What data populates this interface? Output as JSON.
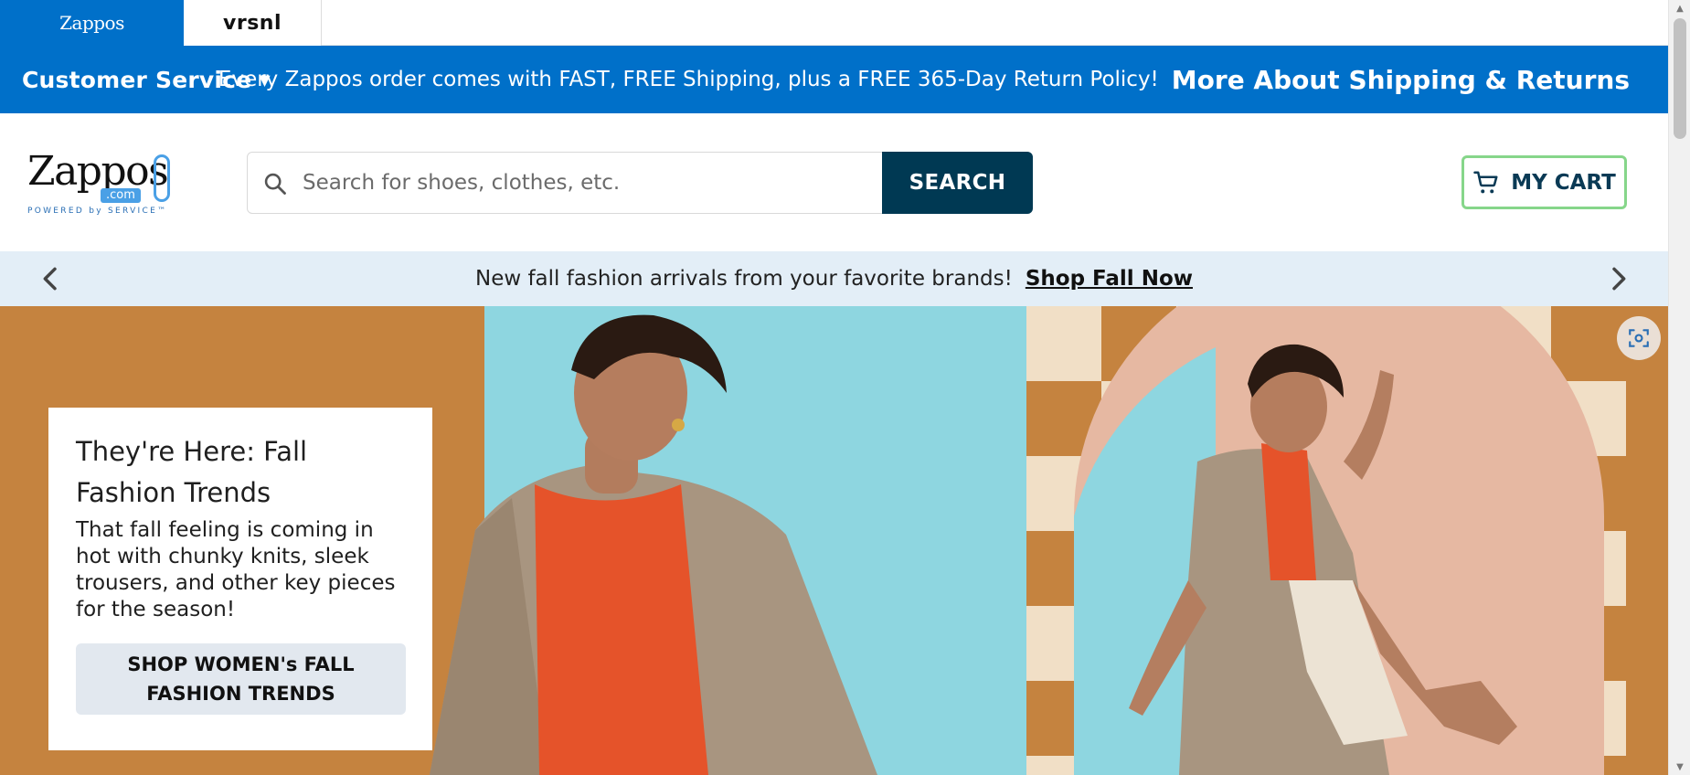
{
  "brand_tabs": {
    "zappos": "Zappos",
    "vrsnl": "vrsnl"
  },
  "service_bar": {
    "customer_service": "Customer Service",
    "shipping_message": "Every Zappos order comes with FAST, FREE Shipping, plus a FREE 365-Day Return Policy!",
    "shipping_link": "More About Shipping & Returns"
  },
  "header": {
    "logo_word": "Zappos",
    "logo_dotcom": ".com",
    "logo_tagline": "POWERED by SERVICE™",
    "search_placeholder": "Search for shoes, clothes, etc.",
    "search_button": "SEARCH",
    "cart_label": "MY CART"
  },
  "promo": {
    "message": "New fall fashion arrivals from your favorite brands!",
    "link": "Shop Fall Now"
  },
  "hero": {
    "title": "They're Here: Fall Fashion Trends",
    "body": "That fall feeling is coming in hot with chunky knits, sleek trousers, and other key pieces for the season!",
    "cta": "SHOP WOMEN's FALL FASHION TRENDS"
  },
  "icons": {
    "search": "search-icon",
    "cart": "cart-icon",
    "prev": "chevron-left-icon",
    "next": "chevron-right-icon",
    "scan": "visual-search-icon",
    "dropdown": "caret-down-icon"
  },
  "colors": {
    "brand_blue": "#0070c9",
    "search_button": "#003953",
    "cart_border": "#86d68a",
    "promo_bg": "#e3eef7",
    "hero_brown": "#c5833f",
    "hero_teal": "#8ed6e0",
    "cta_bg": "#e2e8ef"
  }
}
